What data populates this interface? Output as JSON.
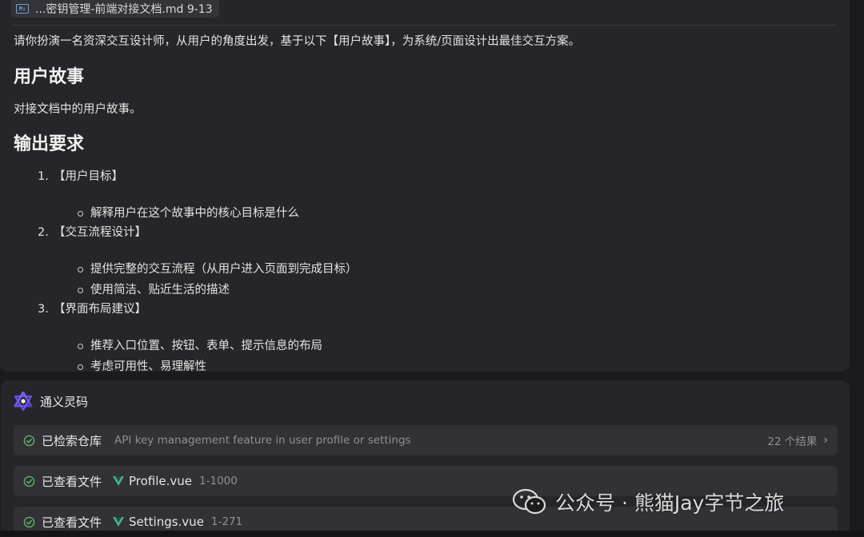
{
  "doc": {
    "file_tab": "...密钥管理-前端对接文档.md 9-13",
    "file_icon": "markdown-icon",
    "intro": "请你扮演一名资深交互设计师，从用户的角度出发，基于以下【用户故事】，为系统/页面设计出最佳交互方案。",
    "h_story": "用户故事",
    "story_text": "对接文档中的用户故事。",
    "h_output": "输出要求",
    "items": [
      {
        "num": "1.",
        "label": "【用户目标】",
        "bullets": [
          "解释用户在这个故事中的核心目标是什么"
        ]
      },
      {
        "num": "2.",
        "label": "【交互流程设计】",
        "bullets": [
          "提供完整的交互流程（从用户进入页面到完成目标）",
          "使用简洁、贴近生活的描述"
        ]
      },
      {
        "num": "3.",
        "label": "【界面布局建议】",
        "bullets": [
          "推荐入口位置、按钮、表单、提示信息的布局",
          "考虑可用性、易理解性"
        ]
      }
    ]
  },
  "assistant": {
    "title": "通义灵码",
    "steps": [
      {
        "title": "已检索仓库",
        "query": "API key management feature in user profile or settings",
        "result": "22 个结果"
      },
      {
        "title": "已查看文件",
        "file": "Profile.vue",
        "range": "1-1000"
      },
      {
        "title": "已查看文件",
        "file": "Settings.vue",
        "range": "1-271"
      }
    ]
  },
  "watermark": {
    "text": "公众号 · 熊猫Jay字节之旅"
  },
  "colors": {
    "panel": "#26262a",
    "background": "#1b1b1d",
    "step": "#313136",
    "check": "#5fb36b",
    "vue": "#42b883"
  }
}
